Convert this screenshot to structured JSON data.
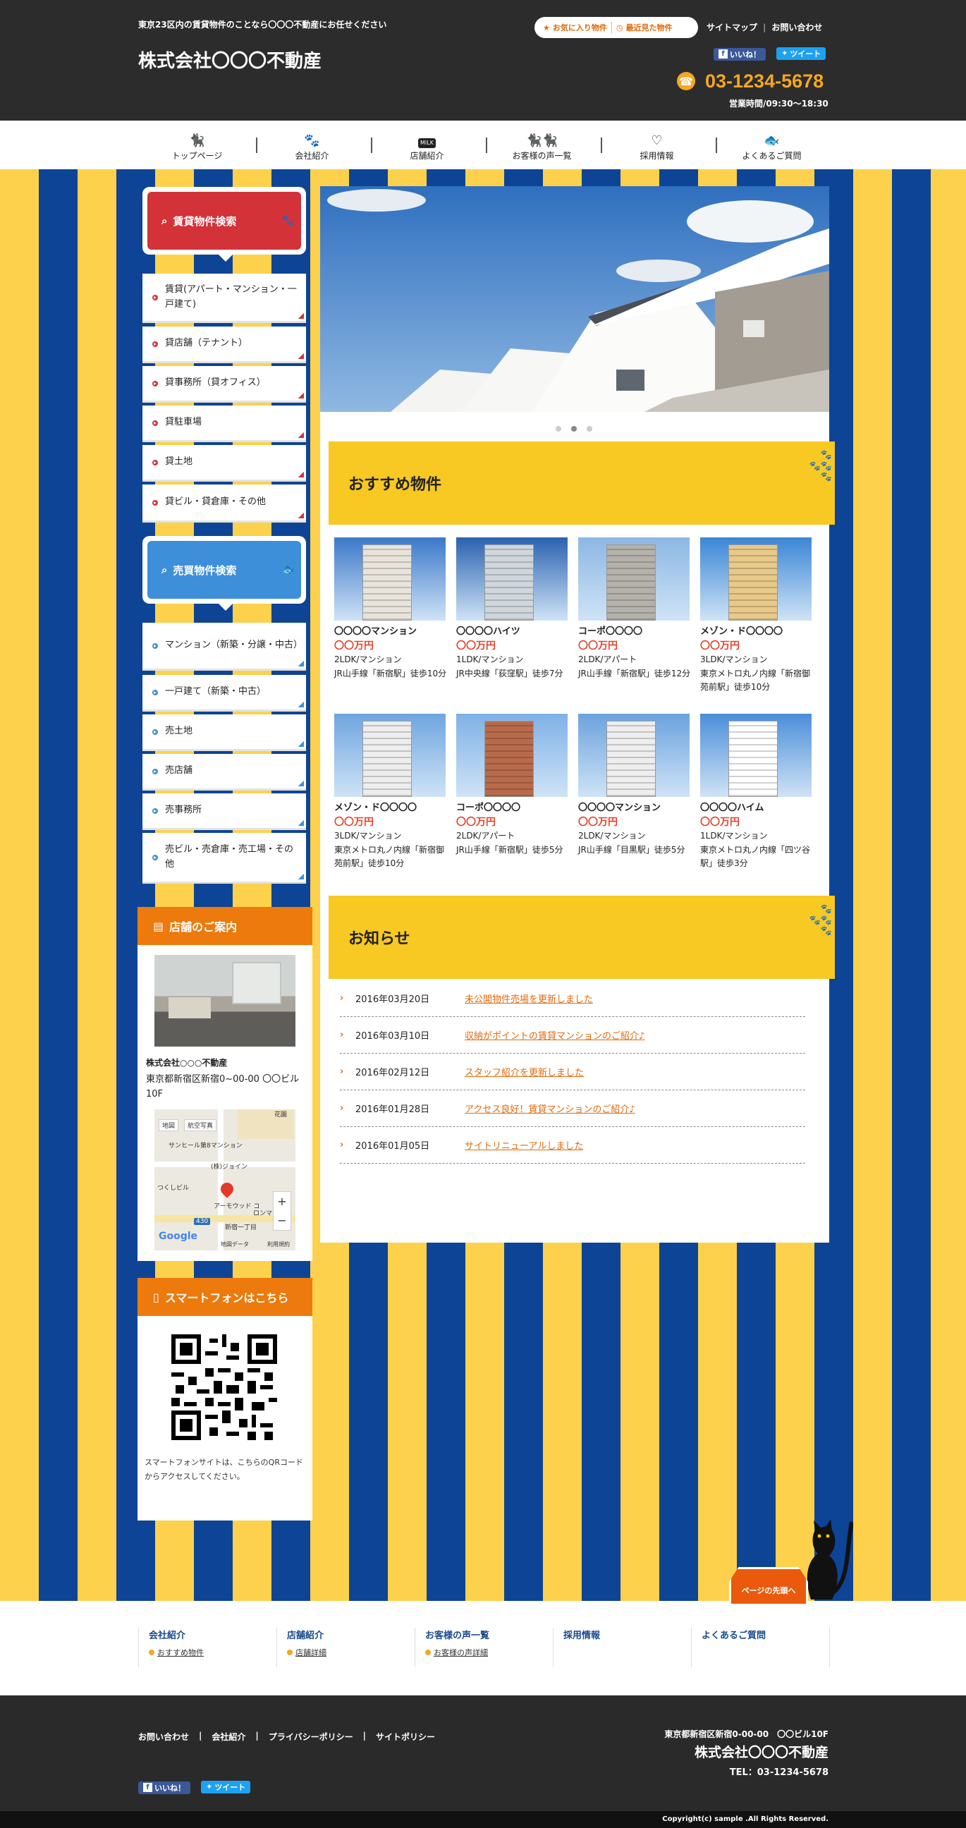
{
  "header": {
    "tagline": "東京23区内の賃貸物件のことなら〇〇〇不動産にお任せください",
    "site_name": "株式会社〇〇〇不動産",
    "favorites": "お気に入り物件",
    "recent": "最近見た物件",
    "sitemap": "サイトマップ",
    "contact": "お問い合わせ",
    "like": "いいね！",
    "tweet": "ツイート",
    "phone": "03-1234-5678",
    "hours": "営業時間/09:30～18:30"
  },
  "nav": [
    {
      "label": "トップページ",
      "icon": "cat-icon"
    },
    {
      "label": "会社紹介",
      "icon": "paw-icon"
    },
    {
      "label": "店舗紹介",
      "icon": "milk-icon"
    },
    {
      "label": "お客様の声一覧",
      "icon": "two-cats-icon"
    },
    {
      "label": "採用情報",
      "icon": "heart-icon"
    },
    {
      "label": "よくあるご質問",
      "icon": "fish-icon"
    }
  ],
  "sidebar": {
    "rent_search": "賃貸物件検索",
    "rent_items": [
      "賃貸(アパート・マンション・一戸建て)",
      "貸店舗（テナント）",
      "貸事務所（貸オフィス）",
      "貸駐車場",
      "貸土地",
      "貸ビル・貸倉庫・その他"
    ],
    "sale_search": "売買物件検索",
    "sale_items": [
      "マンション（新築・分譲・中古）",
      "一戸建て（新築・中古）",
      "売土地",
      "売店舗",
      "売事務所",
      "売ビル・売倉庫・売工場・その他"
    ],
    "store_head": "店舗のご案内",
    "store_name": "株式会社○○○不動産",
    "store_address": "東京都新宿区新宿0~00-00 〇〇ビル10F",
    "map_labels": {
      "map": "地図",
      "photo": "航空写真",
      "sunnyhill": "サンヒール第8マンション",
      "joint": "(株)ジョイン",
      "tsukushi": "つくしビル",
      "harmonywood": "アーモウッド コ",
      "lonnmu": "ロンマ",
      "shinjuku": "新宿一丁目",
      "road": "430",
      "google": "Google",
      "mapdata": "地図データ",
      "terms": "利用規約",
      "hanazono": "花園"
    },
    "phone_head": "スマートフォンはこちら",
    "phone_text": "スマートフォンサイトは、こちらのQRコードからアクセスしてください。"
  },
  "recommend": {
    "title": "おすすめ物件",
    "cards": [
      {
        "name": "〇〇〇〇マンション",
        "price": "〇〇万円",
        "type": "2LDK/マンション",
        "access": "JR山手線「新宿駅」徒歩10分"
      },
      {
        "name": "〇〇〇〇ハイツ",
        "price": "〇〇万円",
        "type": "1LDK/マンション",
        "access": "JR中央線「荻窪駅」徒歩7分"
      },
      {
        "name": "コーポ〇〇〇〇",
        "price": "〇〇万円",
        "type": "2LDK/アパート",
        "access": "JR山手線「新宿駅」徒歩12分"
      },
      {
        "name": "メゾン・ド〇〇〇〇",
        "price": "〇〇万円",
        "type": "3LDK/マンション",
        "access": "東京メトロ丸ノ内線「新宿御苑前駅」徒歩10分"
      },
      {
        "name": "メゾン・ド〇〇〇〇",
        "price": "〇〇万円",
        "type": "3LDK/マンション",
        "access": "東京メトロ丸ノ内線「新宿御苑前駅」徒歩10分"
      },
      {
        "name": "コーポ〇〇〇〇",
        "price": "〇〇万円",
        "type": "2LDK/アパート",
        "access": "JR山手線「新宿駅」徒歩5分"
      },
      {
        "name": "〇〇〇〇マンション",
        "price": "〇〇万円",
        "type": "2LDK/マンション",
        "access": "JR山手線「目黒駅」徒歩5分"
      },
      {
        "name": "〇〇〇〇ハイム",
        "price": "〇〇万円",
        "type": "1LDK/マンション",
        "access": "東京メトロ丸ノ内線「四ツ谷駅」徒歩3分"
      }
    ]
  },
  "news": {
    "title": "お知らせ",
    "items": [
      {
        "date": "2016年03月20日",
        "title": "未公開物件売場を更新しました"
      },
      {
        "date": "2016年03月10日",
        "title": "収納がポイントの賃貸マンションのご紹介♪"
      },
      {
        "date": "2016年02月12日",
        "title": "スタッフ紹介を更新しました"
      },
      {
        "date": "2016年01月28日",
        "title": "アクセス良好！賃貸マンションのご紹介♪"
      },
      {
        "date": "2016年01月05日",
        "title": "サイトリニューアルしました"
      }
    ]
  },
  "page_top": "ページの先頭へ",
  "footer_nav": [
    {
      "title": "会社紹介",
      "sub": "おすすめ物件"
    },
    {
      "title": "店舗紹介",
      "sub": "店舗詳細"
    },
    {
      "title": "お客様の声一覧",
      "sub": "お客様の声詳細"
    },
    {
      "title": "採用情報",
      "sub": ""
    },
    {
      "title": "よくあるご質問",
      "sub": ""
    }
  ],
  "footer": {
    "links": [
      "お問い合わせ",
      "会社紹介",
      "プライバシーポリシー",
      "サイトポリシー"
    ],
    "address": "東京都新宿区新宿0-00-00　〇〇ビル10F",
    "company": "株式会社〇〇〇不動産",
    "tel": "TEL：03-1234-5678",
    "like": "いいね！",
    "tweet": "ツイート",
    "copyright": "Copyright(c) sample .All Rights Reserved."
  },
  "colors": {
    "header_bg": "#2c2c2c",
    "accent_orange": "#ec7a0c",
    "phone_yellow": "#f5a623",
    "stripe_yellow": "#fdd14b",
    "stripe_blue": "#0e4495",
    "rent_red": "#d33239",
    "sale_blue": "#3e8fd9"
  }
}
